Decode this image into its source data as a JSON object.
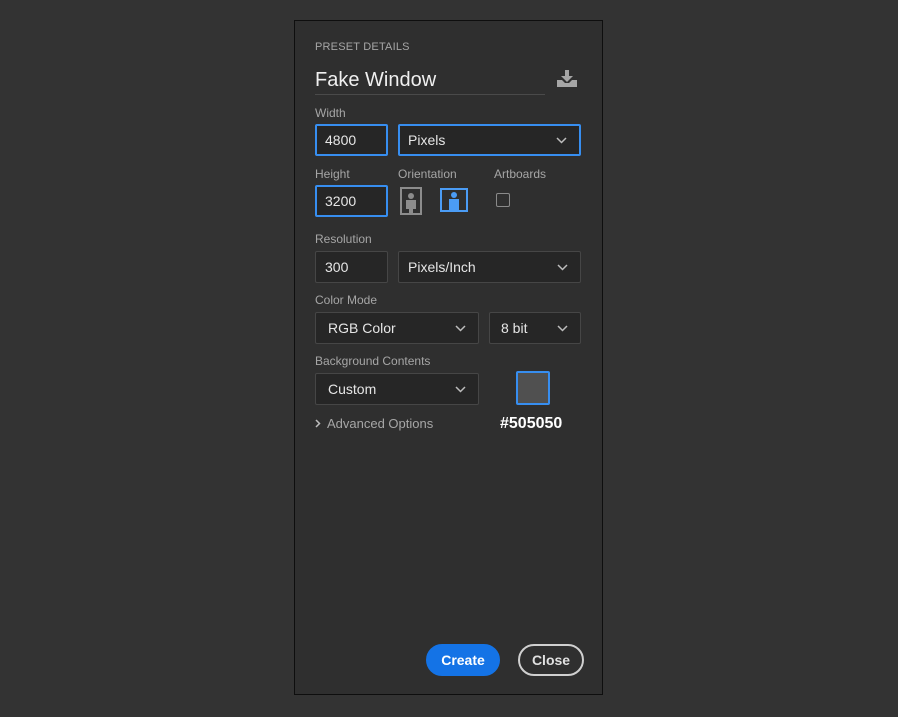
{
  "preset": {
    "section_header": "PRESET DETAILS",
    "name": "Fake Window",
    "save_icon": "save-preset-icon"
  },
  "width": {
    "label": "Width",
    "value": "4800",
    "unit": "Pixels"
  },
  "height": {
    "label": "Height",
    "value": "3200"
  },
  "orientation": {
    "label": "Orientation",
    "selected": "landscape"
  },
  "artboards": {
    "label": "Artboards",
    "checked": false
  },
  "resolution": {
    "label": "Resolution",
    "value": "300",
    "unit": "Pixels/Inch"
  },
  "color_mode": {
    "label": "Color Mode",
    "mode": "RGB Color",
    "depth": "8 bit"
  },
  "background": {
    "label": "Background Contents",
    "value": "Custom",
    "swatch_color": "#505050",
    "hex_label": "#505050"
  },
  "advanced": {
    "label": "Advanced Options"
  },
  "buttons": {
    "create": "Create",
    "close": "Close"
  },
  "colors": {
    "accent": "#1473e6",
    "focus": "#378ef0",
    "panel": "#2f2f2f",
    "background": "#333333"
  }
}
